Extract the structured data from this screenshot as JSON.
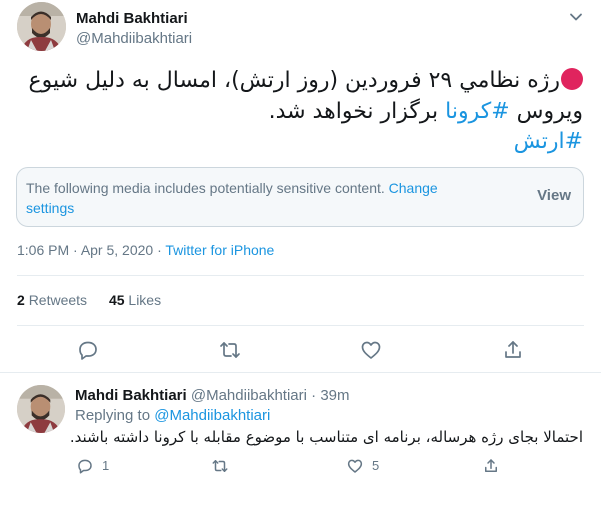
{
  "tweet": {
    "author_name": "Mahdi Bakhtiari",
    "author_handle": "@Mahdiibakhtiari",
    "text_line1": "رژه نظامي ۲۹ فروردين (روز ارتش)، امسال به دليل شيوع",
    "text_line2_prefix": "ويروس",
    "hashtag_corona": "#کرونا",
    "text_line2_suffix": "برگزار نخواهد شد.",
    "hashtag_army": "#ارتش",
    "sensitive_notice": "The following media includes potentially sensitive content.",
    "change_settings": "Change settings",
    "view_label": "View",
    "time": "1:06 PM",
    "date": "Apr 5, 2020",
    "source": "Twitter for iPhone",
    "retweets_count": "2",
    "retweets_label": "Retweets",
    "likes_count": "45",
    "likes_label": "Likes"
  },
  "reply": {
    "author_name": "Mahdi Bakhtiari",
    "author_handle": "@Mahdiibakhtiari",
    "age": "39m",
    "replying_to_label": "Replying to",
    "replying_to_handle": "@Mahdiibakhtiari",
    "text": "احتمالا بجای رژه هرساله، برنامه ای متناسب با موضوع مقابله با کرونا داشته باشند.",
    "reply_count": "1",
    "like_count": "5"
  },
  "colors": {
    "link": "#1b95e0",
    "secondary_text": "#657786",
    "primary_text": "#14171a",
    "red_circle": "#e0245e",
    "divider": "#e6ecf0"
  },
  "icons": [
    "red-circle-icon",
    "chevron-down-icon",
    "reply-icon",
    "retweet-icon",
    "like-icon",
    "share-icon"
  ]
}
